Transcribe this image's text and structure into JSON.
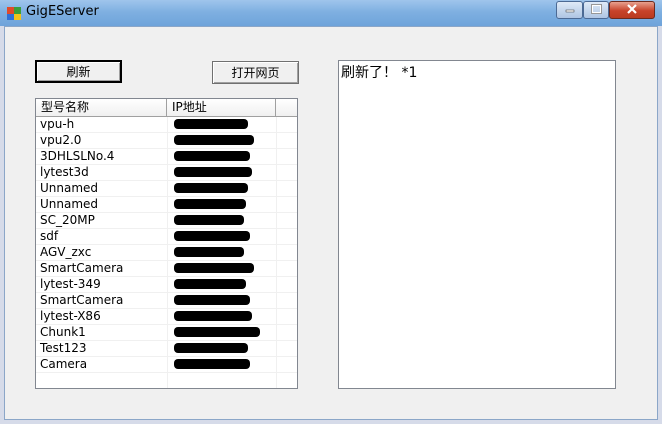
{
  "window": {
    "title": "GigEServer"
  },
  "toolbar": {
    "refresh_label": "刷新",
    "open_web_label": "打开网页"
  },
  "device_list": {
    "columns": [
      "型号名称",
      "IP地址"
    ],
    "rows": [
      {
        "name": "vpu-h",
        "ip_redacted": true
      },
      {
        "name": "vpu2.0",
        "ip_redacted": true
      },
      {
        "name": "3DHLSLNo.4",
        "ip_redacted": true
      },
      {
        "name": "lytest3d",
        "ip_redacted": true
      },
      {
        "name": "Unnamed",
        "ip_redacted": true
      },
      {
        "name": "Unnamed",
        "ip_redacted": true
      },
      {
        "name": "SC_20MP",
        "ip_redacted": true
      },
      {
        "name": "sdf",
        "ip_redacted": true
      },
      {
        "name": "AGV_zxc",
        "ip_redacted": true
      },
      {
        "name": "SmartCamera",
        "ip_redacted": true
      },
      {
        "name": "lytest-349",
        "ip_redacted": true
      },
      {
        "name": "SmartCamera",
        "ip_redacted": true
      },
      {
        "name": "lytest-X86",
        "ip_redacted": true
      },
      {
        "name": "Chunk1",
        "ip_redacted": true
      },
      {
        "name": "Test123",
        "ip_redacted": true
      },
      {
        "name": "Camera",
        "ip_redacted": true
      }
    ]
  },
  "log": {
    "text": "刷新了！ *1"
  },
  "icons": {
    "app": "app-icon",
    "minimize": "minimize-icon",
    "maximize": "maximize-icon",
    "close": "close-icon"
  }
}
